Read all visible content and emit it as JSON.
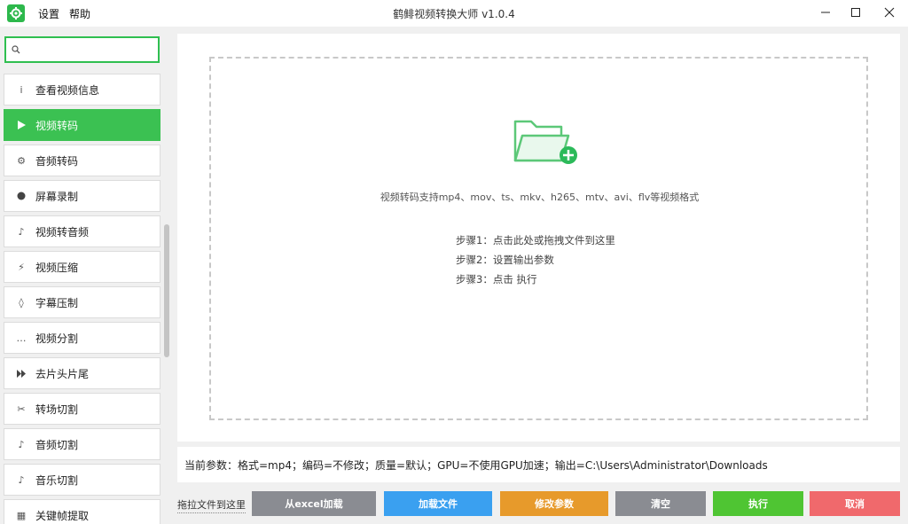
{
  "window": {
    "title": "鹤鲱视频转换大师 v1.0.4"
  },
  "menu": {
    "settings": "设置",
    "help": "帮助"
  },
  "search": {
    "placeholder": "",
    "value": ""
  },
  "sidebar": {
    "items": [
      {
        "label": "查看视频信息",
        "icon": "info-icon",
        "active": false
      },
      {
        "label": "视频转码",
        "icon": "play-icon",
        "active": true
      },
      {
        "label": "音频转码",
        "icon": "gear-icon",
        "active": false
      },
      {
        "label": "屏幕录制",
        "icon": "record-icon",
        "active": false
      },
      {
        "label": "视频转音频",
        "icon": "music-note-icon",
        "active": false
      },
      {
        "label": "视频压缩",
        "icon": "lightning-icon",
        "active": false
      },
      {
        "label": "字幕压制",
        "icon": "diamond-icon",
        "active": false
      },
      {
        "label": "视频分割",
        "icon": "ellipsis-icon",
        "active": false
      },
      {
        "label": "去片头片尾",
        "icon": "fast-forward-icon",
        "active": false
      },
      {
        "label": "转场切割",
        "icon": "scissors-icon",
        "active": false
      },
      {
        "label": "音频切割",
        "icon": "music-note-icon",
        "active": false
      },
      {
        "label": "音乐切割",
        "icon": "music-note-icon",
        "active": false
      },
      {
        "label": "关键帧提取",
        "icon": "grid-icon",
        "active": false
      }
    ]
  },
  "dropzone": {
    "formats": "视频转码支持mp4、mov、ts、mkv、h265、mtv、avi、flv等视频格式",
    "step1": "步骤1：点击此处或拖拽文件到这里",
    "step2": "步骤2：设置输出参数",
    "step3": "步骤3：点击 执行"
  },
  "status": {
    "text": "当前参数：格式=mp4；编码=不修改；质量=默认；GPU=不使用GPU加速；输出=C:\\Users\\Administrator\\Downloads"
  },
  "toolbar": {
    "drag_hint": "拖拉文件到这里",
    "excel": "从excel加载",
    "add_file": "加载文件",
    "modify_params": "修改参数",
    "clear": "清空",
    "run": "执行",
    "cancel": "取消"
  },
  "colors": {
    "accent": "#3bc152",
    "excel": "#8a8c92",
    "add": "#3aa0f0",
    "params": "#e79a2b",
    "clear": "#8a8c92",
    "run": "#4fc533",
    "cancel": "#f0696c"
  }
}
